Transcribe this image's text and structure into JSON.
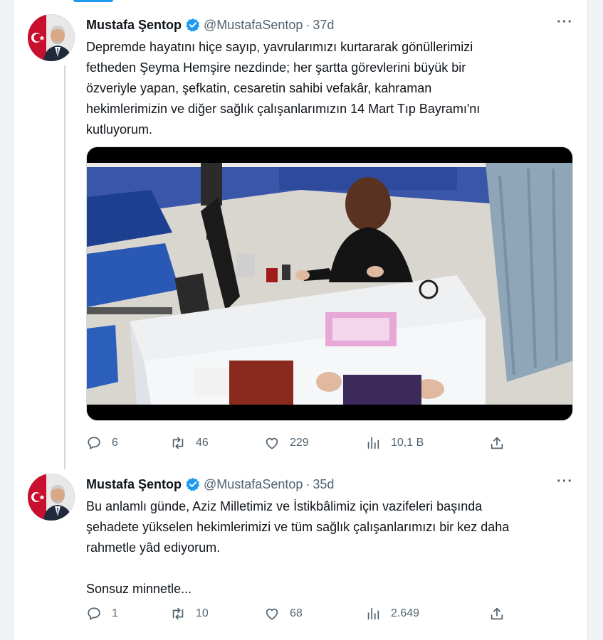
{
  "tweets": [
    {
      "author_name": "Mustafa Şentop",
      "handle": "@MustafaSentop",
      "separator": "·",
      "time": "37d",
      "more_label": "···",
      "text": "Depremde hayatını hiçe sayıp, yavrularımızı kurtararak gönüllerimizi\nfetheden Şeyma Hemşire nezdinde; her şartta görevlerini büyük bir\nözveriyle yapan, şefkatin, cesaretin sahibi vefakâr, kahraman\nhekimlerimizin ve diğer sağlık çalışanlarımızın 14 Mart Tıp Bayramı'nı\nkutluyorum.",
      "replies": "6",
      "retweets": "46",
      "likes": "229",
      "views": "10,1 B"
    },
    {
      "author_name": "Mustafa Şentop",
      "handle": "@MustafaSentop",
      "separator": "·",
      "time": "35d",
      "more_label": "···",
      "text": "Bu anlamlı günde, Aziz Milletimiz ve İstikbâlimiz için vazifeleri başında\nşehadete yükselen hekimlerimizi ve tüm sağlık çalışanlarımızı bir kez daha\nrahmetle yâd ediyorum.\n\nSonsuz minnetle...",
      "replies": "1",
      "retweets": "10",
      "likes": "68",
      "views": "2.649"
    }
  ],
  "icons": {
    "verified": "verified-badge-icon",
    "reply": "reply-icon",
    "retweet": "retweet-icon",
    "like": "heart-icon",
    "views": "views-icon",
    "share": "share-icon"
  },
  "colors": {
    "accent": "#1d9bf0",
    "text": "#0f1419",
    "muted": "#536471",
    "thread_line": "#cfd9de"
  }
}
